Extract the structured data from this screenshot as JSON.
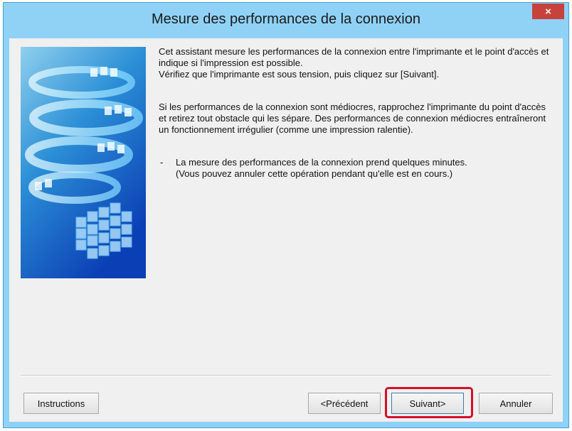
{
  "window": {
    "title": "Mesure des performances de la connexion",
    "close_label": "×"
  },
  "content": {
    "paragraph1_line1": "Cet assistant mesure les performances de la connexion entre l'imprimante et le point d'accès et indique si l'impression est possible.",
    "paragraph1_line2": "Vérifiez que l'imprimante est sous tension, puis cliquez sur [Suivant].",
    "paragraph2": "Si les performances de la connexion sont médiocres, rapprochez l'imprimante du point d'accès et retirez tout obstacle qui les sépare. Des performances de connexion médiocres entraîneront un fonctionnement irrégulier (comme une impression ralentie).",
    "bullet_dash": "-",
    "bullet_line1": "La mesure des performances de la connexion prend quelques minutes.",
    "bullet_line2": "(Vous pouvez annuler cette opération pendant qu'elle est en cours.)"
  },
  "buttons": {
    "instructions": "Instructions",
    "previous": "<Précédent",
    "next": "Suivant>",
    "cancel": "Annuler"
  },
  "colors": {
    "titlebar": "#8fd2f6",
    "close_button": "#c7423b",
    "highlight": "#d3102a"
  },
  "icons": {
    "illustration": "network-spiral-illustration",
    "close": "close-icon"
  }
}
